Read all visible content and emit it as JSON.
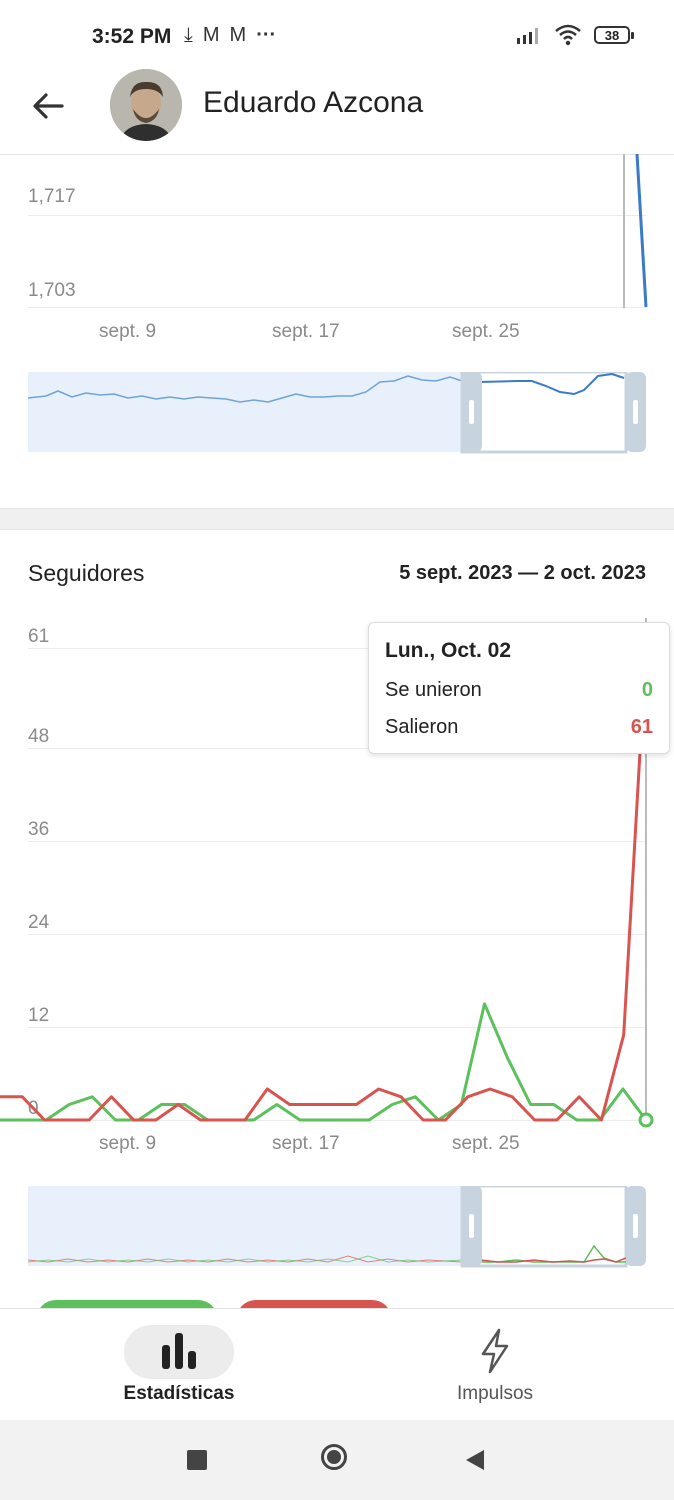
{
  "status_bar": {
    "time": "3:52 PM",
    "battery": "38"
  },
  "header": {
    "name": "Eduardo Azcona"
  },
  "top_chart": {
    "y_ticks": [
      "1,717",
      "1,703"
    ],
    "x_ticks": [
      "sept. 9",
      "sept. 17",
      "sept. 25"
    ]
  },
  "followers": {
    "title": "Seguidores",
    "date_range": "5 sept. 2023 — 2 oct. 2023",
    "tooltip": {
      "date": "Lun., Oct. 02",
      "joined_label": "Se unieron",
      "joined_value": "0",
      "left_label": "Salieron",
      "left_value": "61"
    }
  },
  "chart_data": [
    {
      "type": "line",
      "title": "",
      "x": [
        "sept. 5",
        "sept. 6",
        "sept. 7",
        "sept. 8",
        "sept. 9",
        "sept. 10",
        "sept. 11",
        "sept. 12",
        "sept. 13",
        "sept. 14",
        "sept. 15",
        "sept. 16",
        "sept. 17",
        "sept. 18",
        "sept. 19",
        "sept. 20",
        "sept. 21",
        "sept. 22",
        "sept. 23",
        "sept. 24",
        "sept. 25",
        "sept. 26",
        "sept. 27",
        "sept. 28",
        "sept. 29",
        "sept. 30",
        "oct. 1",
        "oct. 2"
      ],
      "series": [
        {
          "values": [
            0,
            0,
            0,
            2,
            3,
            0,
            0,
            2,
            2,
            0,
            0,
            0,
            2,
            0,
            0,
            0,
            0,
            2,
            3,
            0,
            2,
            15,
            8,
            2,
            2,
            0,
            0,
            4,
            0
          ],
          "color": "#5cc05c"
        },
        {
          "values": [
            3,
            3,
            0,
            0,
            0,
            3,
            0,
            0,
            2,
            0,
            0,
            0,
            4,
            2,
            2,
            2,
            2,
            4,
            3,
            0,
            0,
            3,
            4,
            3,
            0,
            0,
            3,
            0,
            11,
            61
          ],
          "color": "#d9534f"
        }
      ],
      "y_ticks": [
        "61",
        "48",
        "36",
        "24",
        "12",
        "0"
      ],
      "x_ticks": [
        "sept. 9",
        "sept. 17",
        "sept. 25"
      ],
      "ylim": [
        0,
        61
      ]
    }
  ],
  "bottom_nav": {
    "stats_label": "Estadísticas",
    "boosts_label": "Impulsos"
  },
  "colors": {
    "joined": "#5cc05c",
    "left": "#d9534f",
    "views": "#3a7bc8",
    "navigator_fill": "#e8f1fb"
  }
}
